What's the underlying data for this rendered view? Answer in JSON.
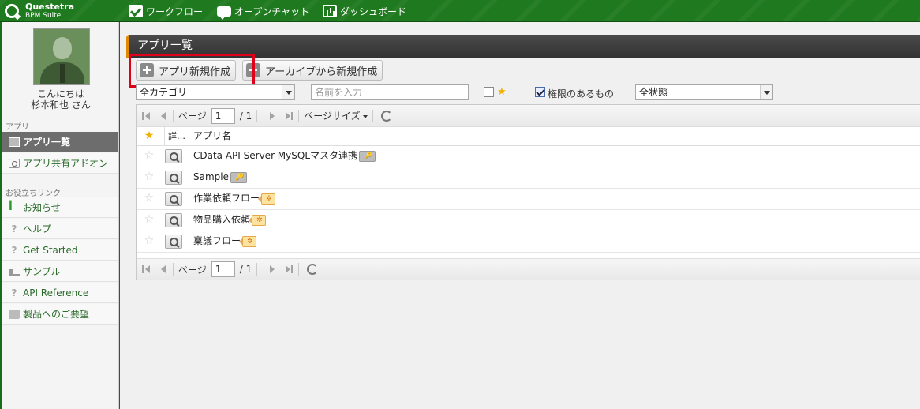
{
  "header": {
    "logo_line1": "Questetra",
    "logo_line2": "BPM Suite",
    "nav": [
      {
        "label": "ワークフロー",
        "icon": "workflow-check-icon"
      },
      {
        "label": "オープンチャット",
        "icon": "chat-bubble-icon"
      },
      {
        "label": "ダッシュボード",
        "icon": "dashboard-icon"
      }
    ]
  },
  "sidebar": {
    "greeting1": "こんにちは",
    "greeting2": "杉本和也 さん",
    "section_app": "アプリ",
    "app_items": [
      {
        "label": "アプリ一覧",
        "icon": "app-list-icon"
      },
      {
        "label": "アプリ共有アドオン",
        "icon": "addon-icon"
      }
    ],
    "section_links": "お役立ちリンク",
    "link_items": [
      {
        "label": "お知らせ",
        "icon": "news-icon"
      },
      {
        "label": "ヘルプ",
        "icon": "help-icon"
      },
      {
        "label": "Get Started",
        "icon": "help-icon"
      },
      {
        "label": "サンプル",
        "icon": "sample-icon"
      },
      {
        "label": "API Reference",
        "icon": "help-icon"
      },
      {
        "label": "製品へのご要望",
        "icon": "feedback-icon"
      }
    ]
  },
  "main": {
    "title": "アプリ一覧",
    "new_app_label": "アプリ新規作成",
    "archive_label": "アーカイブから新規作成",
    "filters": {
      "category_value": "全カテゴリ",
      "name_placeholder": "名前を入力",
      "permission_label": "権限のあるもの",
      "status_value": "全状態"
    },
    "pager": {
      "page_label": "ページ",
      "page_value": "1",
      "total": "/ 1",
      "page_size_label": "ページサイズ"
    },
    "columns": {
      "detail": "詳…",
      "name": "アプリ名"
    },
    "rows": [
      {
        "name": "CData API Server MySQLマスタ連携",
        "tag": "🔑",
        "tag_style": "gray"
      },
      {
        "name": "Sample",
        "tag": "🔑",
        "tag_style": "gray"
      },
      {
        "name": "作業依頼フロー",
        "tag": "✲",
        "tag_style": "orange"
      },
      {
        "name": "物品購入依頼",
        "tag": "✲",
        "tag_style": "orange"
      },
      {
        "name": "稟議フロー",
        "tag": "✲",
        "tag_style": "orange"
      }
    ]
  }
}
